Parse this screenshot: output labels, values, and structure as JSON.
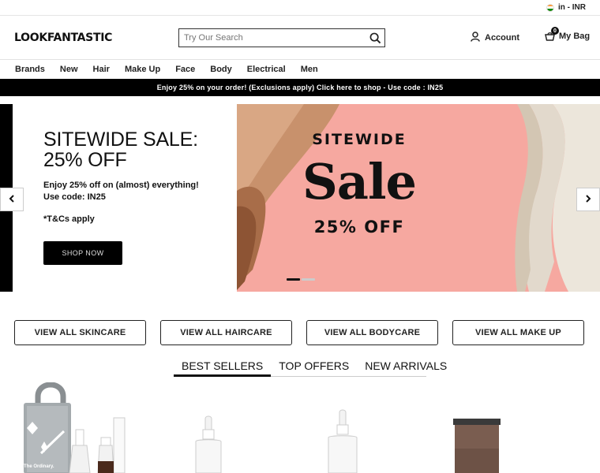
{
  "topbar": {
    "locale": "in - INR"
  },
  "header": {
    "logo": "LOOKFANTASTIC",
    "search_placeholder": "Try Our Search",
    "account_label": "Account",
    "bag_label": "My Bag",
    "bag_count": "0"
  },
  "nav": {
    "items": [
      "Brands",
      "New",
      "Hair",
      "Make Up",
      "Face",
      "Body",
      "Electrical",
      "Men"
    ]
  },
  "promo": {
    "text": "Enjoy 25% on your order! (Exclusions apply) Click here to shop - Use code : IN25"
  },
  "hero": {
    "title": "SITEWIDE SALE: 25% OFF",
    "description": "Enjoy 25% off on (almost) everything! Use code: IN25",
    "tcs": "*T&Cs apply",
    "cta": "SHOP NOW",
    "banner_line1": "SITEWIDE",
    "banner_line2": "Sale",
    "banner_line3": "25% OFF",
    "banner_bg": "#f6a8a0"
  },
  "categories": [
    "VIEW ALL SKINCARE",
    "VIEW ALL HAIRCARE",
    "VIEW ALL BODYCARE",
    "VIEW ALL MAKE UP"
  ],
  "tabs": [
    "BEST SELLERS",
    "TOP OFFERS",
    "NEW ARRIVALS"
  ],
  "products": {
    "brand_label": "The Ordinary."
  }
}
